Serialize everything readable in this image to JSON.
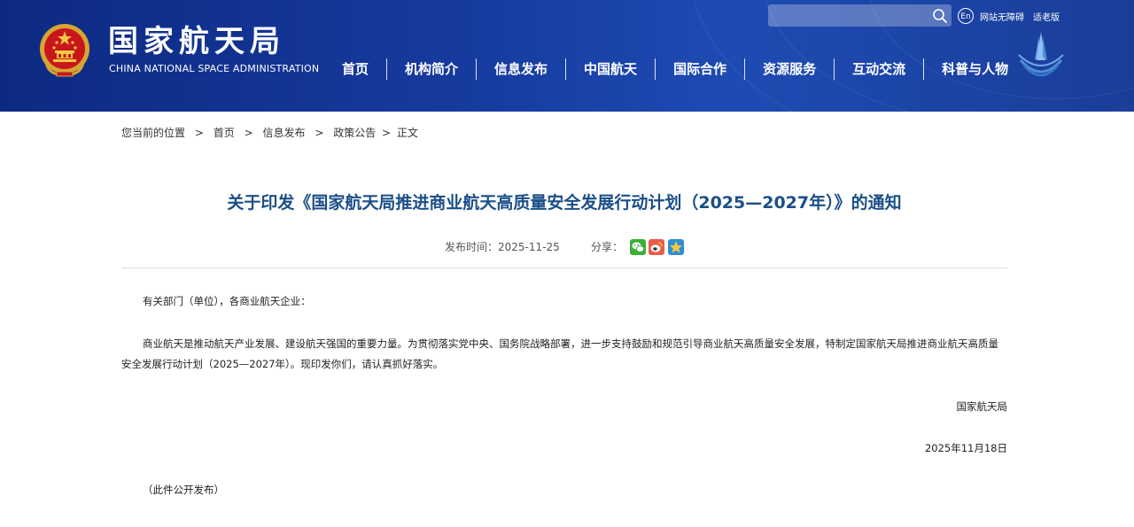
{
  "header": {
    "site_name_cn": "国家航天局",
    "site_name_en": "CHINA NATIONAL SPACE ADMINISTRATION",
    "search_placeholder": "",
    "lang_label": "En",
    "accessibility_label": "网站无障碍",
    "elderly_label": "适老版",
    "nav": [
      "首页",
      "机构简介",
      "信息发布",
      "中国航天",
      "国际合作",
      "资源服务",
      "互动交流",
      "科普与人物"
    ]
  },
  "breadcrumb": {
    "prefix": "您当前的位置",
    "items": [
      "首页",
      "信息发布",
      "政策公告",
      "正文"
    ],
    "sep": ">"
  },
  "article": {
    "title": "关于印发《国家航天局推进商业航天高质量安全发展行动计划（2025—2027年）》的通知",
    "publish_label": "发布时间：2025-11-25",
    "share_label": "分享：",
    "share_icons": [
      "wechat-icon",
      "weibo-icon",
      "qzone-icon"
    ],
    "salutation": "有关部门（单位），各商业航天企业：",
    "paragraph": "商业航天是推动航天产业发展、建设航天强国的重要力量。为贯彻落实党中央、国务院战略部署，进一步支持鼓励和规范引导商业航天高质量安全发展，特制定国家航天局推进商业航天高质量安全发展行动计划（2025—2027年）。现印发你们，请认真抓好落实。",
    "signature": "国家航天局",
    "date": "2025年11月18日",
    "note": "（此件公开发布）"
  },
  "colors": {
    "header_bg": "#163a9e",
    "title": "#1b4f87",
    "wechat": "#3cb034",
    "weibo": "#e85c4a",
    "qzone": "#2f8fd6"
  }
}
